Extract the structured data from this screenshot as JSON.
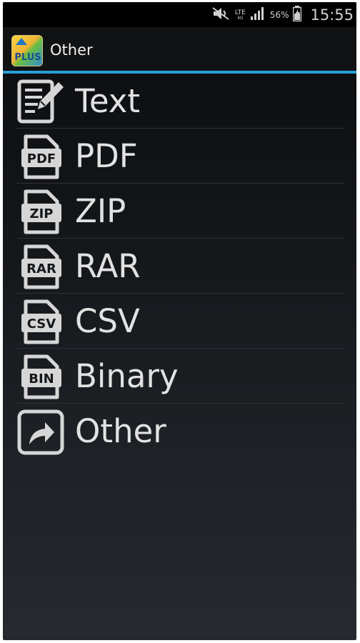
{
  "status_bar": {
    "network": "LTE",
    "network_sub": "4G",
    "battery": "56%",
    "time": "15:55",
    "icons": [
      "mute-icon",
      "lte-icon",
      "signal-icon",
      "battery-icon"
    ]
  },
  "action_bar": {
    "logo_text": "PLUS",
    "title": "Other",
    "accent_color": "#2a9fd8"
  },
  "items": [
    {
      "label": "Text",
      "icon": "text-edit-icon",
      "badge": ""
    },
    {
      "label": "PDF",
      "icon": "pdf-file-icon",
      "badge": "PDF"
    },
    {
      "label": "ZIP",
      "icon": "zip-file-icon",
      "badge": "ZIP"
    },
    {
      "label": "RAR",
      "icon": "rar-file-icon",
      "badge": "RAR"
    },
    {
      "label": "CSV",
      "icon": "csv-file-icon",
      "badge": "CSV"
    },
    {
      "label": "Binary",
      "icon": "bin-file-icon",
      "badge": "BIN"
    },
    {
      "label": "Other",
      "icon": "shortcut-arrow-icon",
      "badge": ""
    }
  ]
}
